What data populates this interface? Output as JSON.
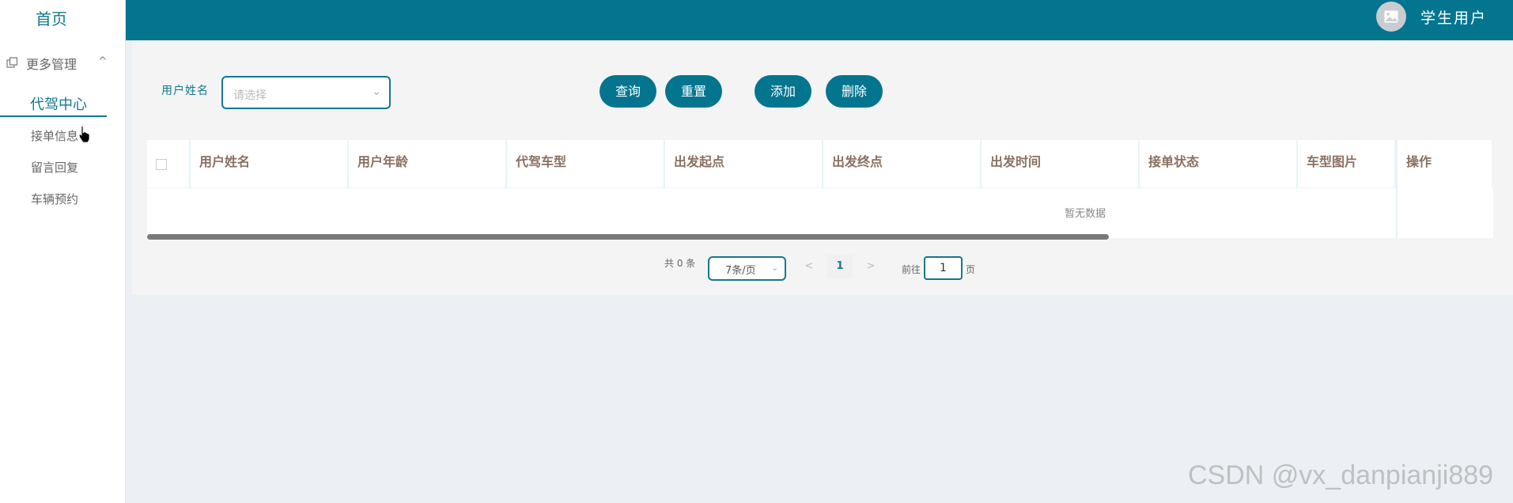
{
  "sidebar": {
    "home": "首页",
    "group_label": "更多管理",
    "group_chevron": "^",
    "active_item": "代驾中心",
    "items": [
      {
        "label": "接单信息"
      },
      {
        "label": "留言回复"
      },
      {
        "label": "车辆预约"
      }
    ]
  },
  "header": {
    "username": "学生用户"
  },
  "search": {
    "label": "用户姓名",
    "placeholder": "请选择",
    "query_button": "查询",
    "reset_button": "重置",
    "add_button": "添加",
    "delete_button": "删除"
  },
  "table": {
    "columns": [
      "用户姓名",
      "用户年龄",
      "代驾车型",
      "出发起点",
      "出发终点",
      "出发时间",
      "接单状态",
      "车型图片",
      "操作"
    ],
    "empty_text": "暂无数据"
  },
  "pagination": {
    "total_text": "共 0 条",
    "page_size": "7条/页",
    "prev": "<",
    "current_page": "1",
    "next": ">",
    "goto_label": "前往",
    "goto_value": "1",
    "page_suffix": "页"
  },
  "watermark": "CSDN @vx_danpianji889",
  "colors": {
    "primary": "#04758f",
    "accent_text": "#12798f",
    "header_text": "#8a7060"
  }
}
